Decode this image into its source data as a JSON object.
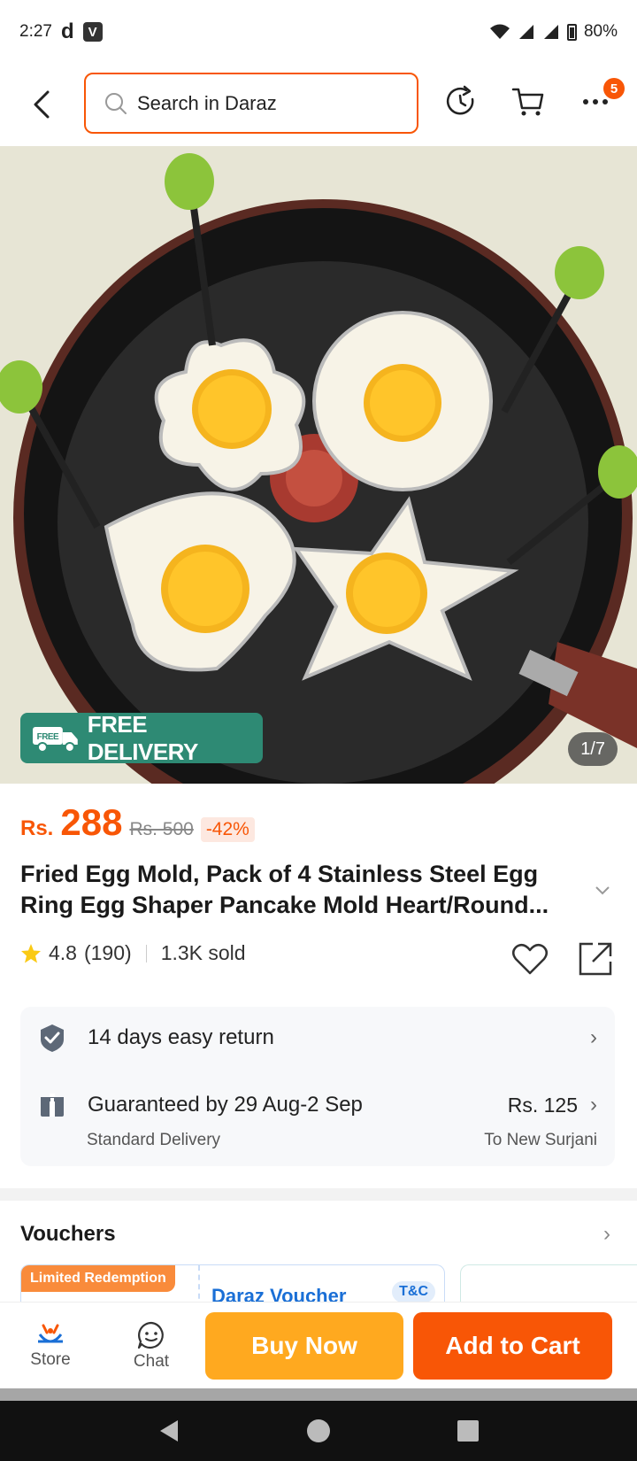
{
  "status_bar": {
    "time": "2:27",
    "d_icon": "d",
    "v_icon": "V",
    "battery": "80%"
  },
  "header": {
    "search_placeholder": "Search in Daraz",
    "menu_badge": "5"
  },
  "hero": {
    "free_delivery": "FREE DELIVERY",
    "free_tag": "FREE",
    "image_counter": "1/7"
  },
  "price": {
    "currency": "Rs.",
    "current": "288",
    "original": "Rs. 500",
    "discount": "-42%"
  },
  "product": {
    "title": "Fried Egg Mold, Pack of 4 Stainless Steel Egg Ring Egg Shaper Pancake Mold Heart/Round...",
    "rating": "4.8",
    "reviews": "(190)",
    "sold": "1.3K sold"
  },
  "service": {
    "return_text": "14 days easy return",
    "guarantee_text": "Guaranteed by 29 Aug-2 Sep",
    "shipping_price": "Rs. 125",
    "delivery_type": "Standard Delivery",
    "destination": "To New Surjani"
  },
  "vouchers": {
    "title": "Vouchers",
    "limited_label": "Limited Redemption",
    "voucher_name": "Daraz Voucher",
    "tc_label": "T&C"
  },
  "bottom_bar": {
    "store": "Store",
    "chat": "Chat",
    "buy_now": "Buy Now",
    "add_to_cart": "Add to Cart"
  },
  "colors": {
    "brand_orange": "#f85606",
    "buy_now": "#ffa91f",
    "free_delivery_green": "#2e8a74"
  }
}
